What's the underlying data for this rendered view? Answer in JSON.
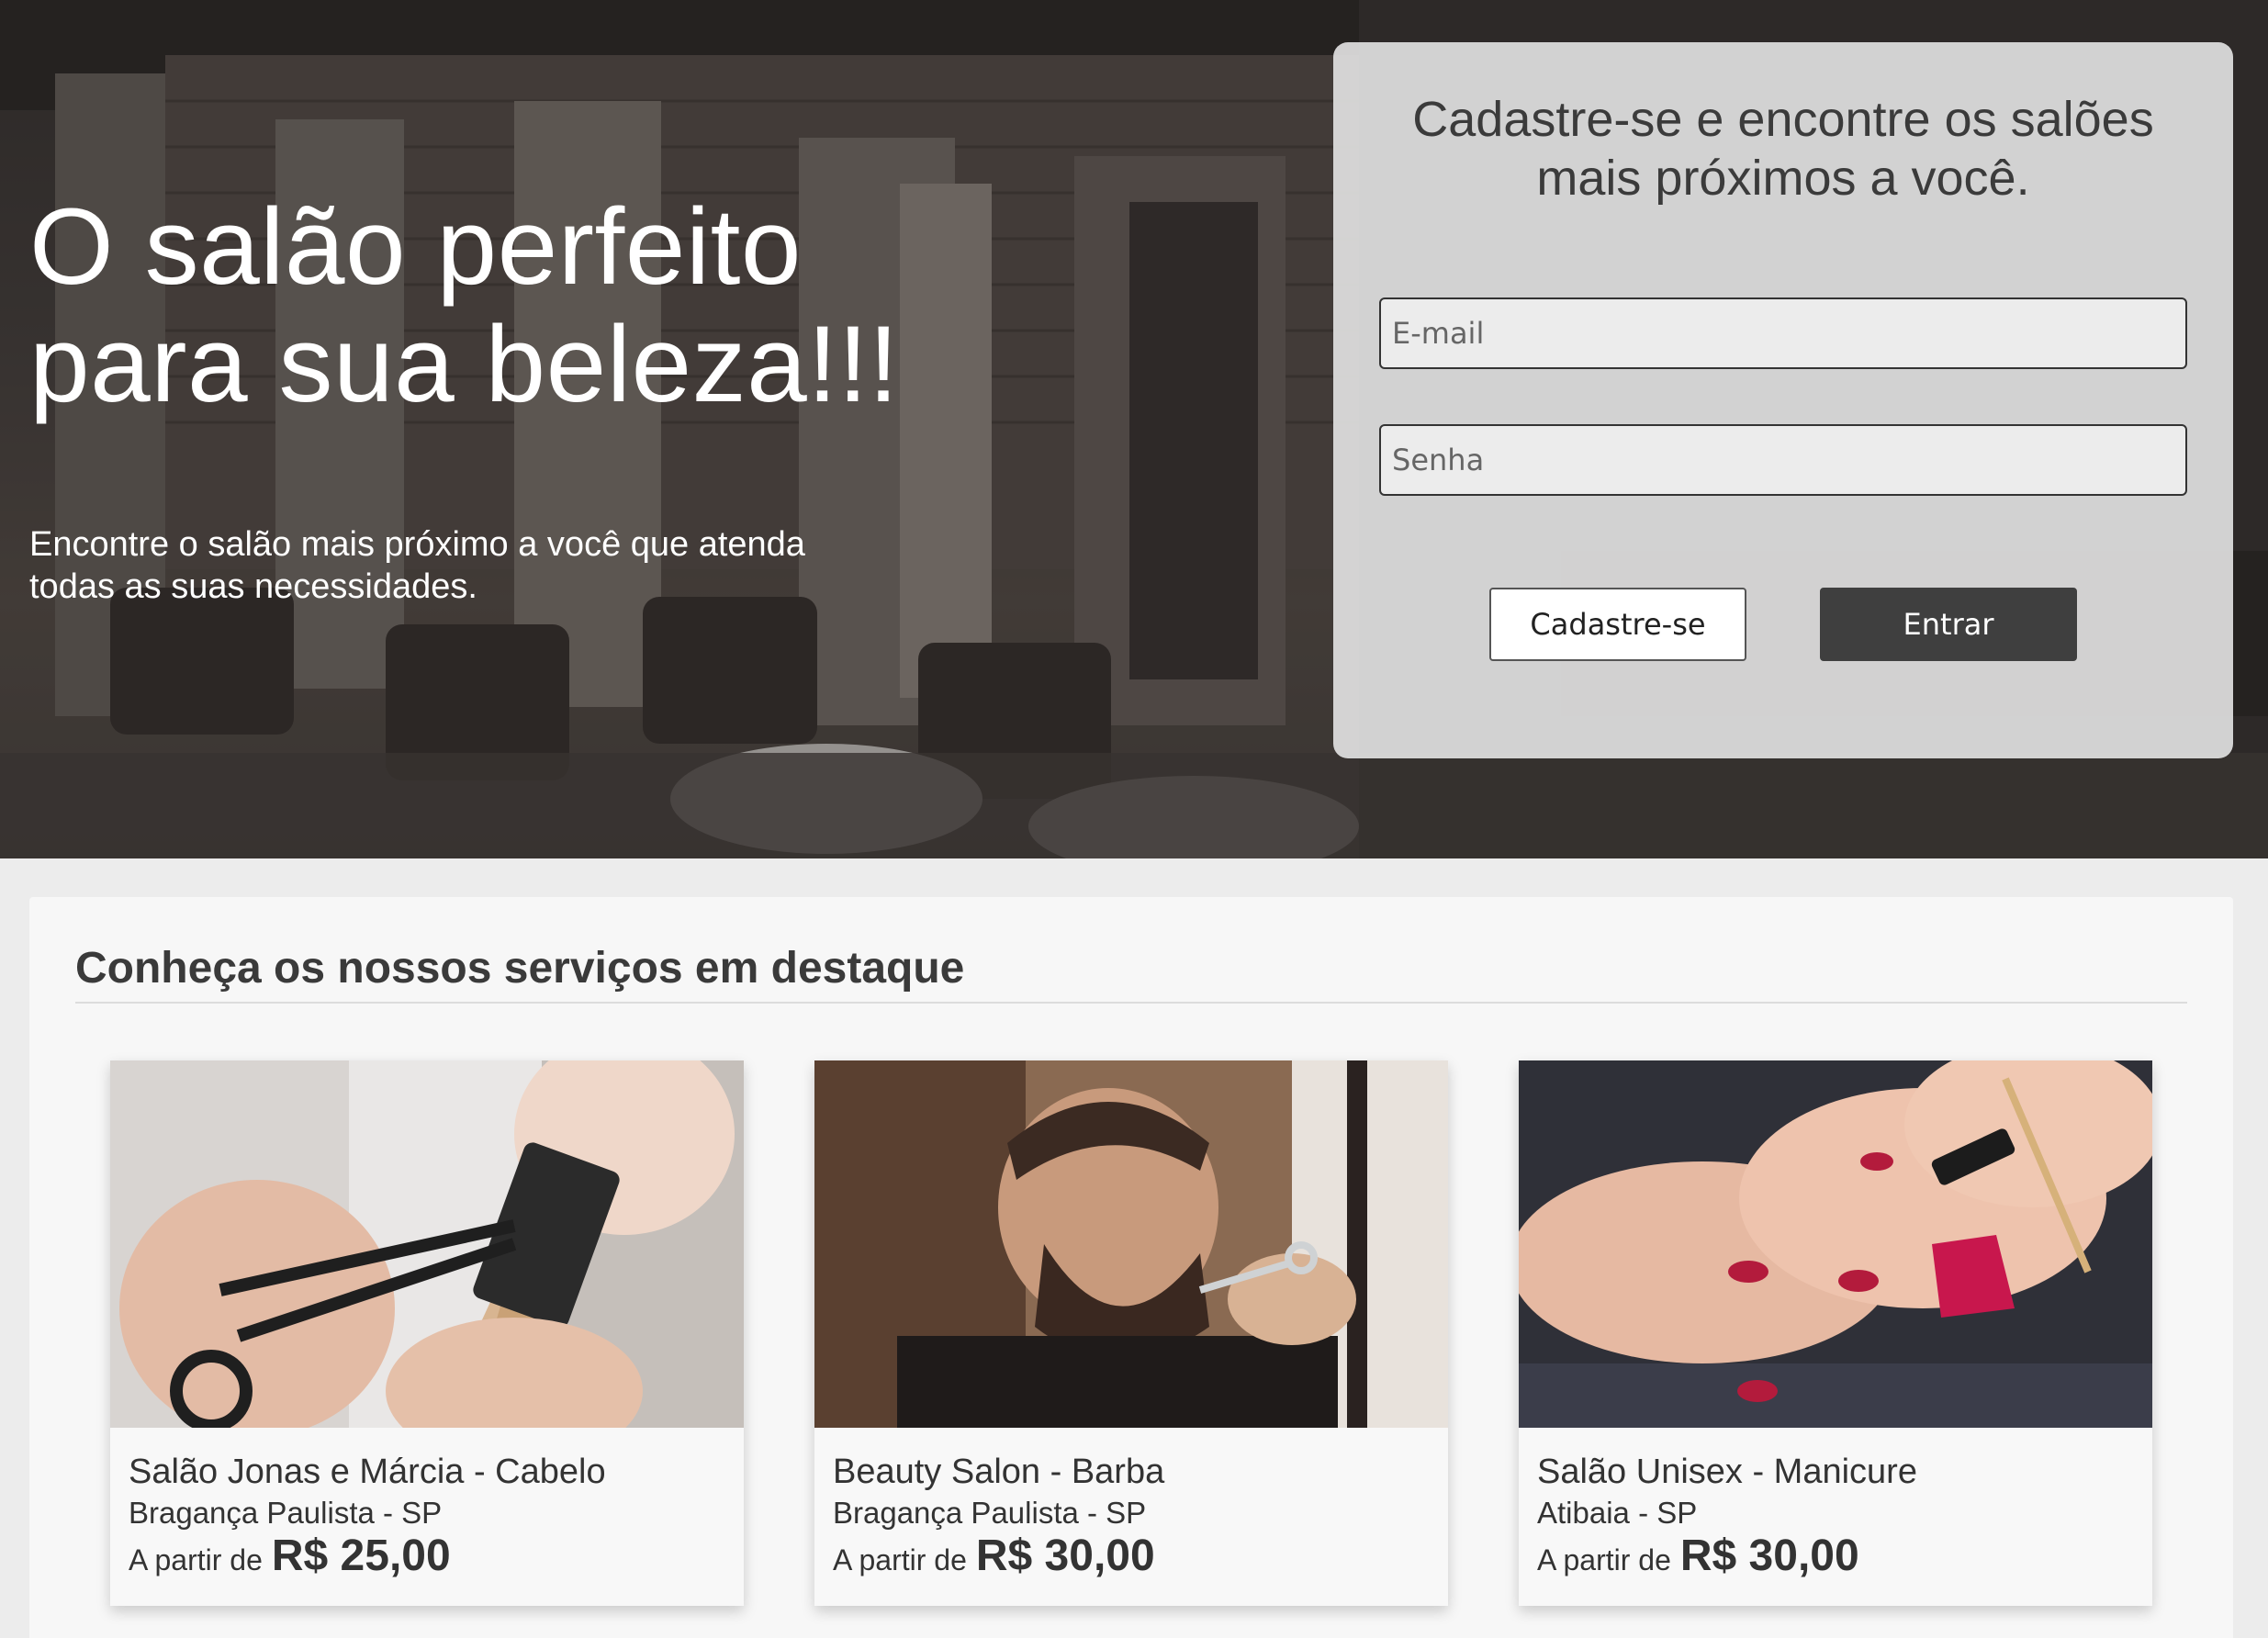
{
  "hero": {
    "title_line1": "O salão perfeito",
    "title_line2": "para sua beleza!!!",
    "subtitle_line1": "Encontre o salão mais próximo a você que atenda",
    "subtitle_line2": "todas as suas necessidades."
  },
  "login": {
    "title_line1": "Cadastre-se e encontre os salões",
    "title_line2": "mais próximos a você.",
    "email_placeholder": "E-mail",
    "password_placeholder": "Senha",
    "signup_label": "Cadastre-se",
    "login_label": "Entrar"
  },
  "services": {
    "title": "Conheça os nossos serviços em destaque",
    "cards": [
      {
        "name": "Salão Jonas e Márcia - Cabelo",
        "location": "Bragança Paulista - SP",
        "from_label": "A partir de",
        "price": "R$ 25,00",
        "image": "haircut-photo"
      },
      {
        "name": "Beauty Salon - Barba",
        "location": "Bragança Paulista - SP",
        "from_label": "A partir de",
        "price": "R$ 30,00",
        "image": "beard-trim-photo"
      },
      {
        "name": "Salão Unisex - Manicure",
        "location": "Atibaia - SP",
        "from_label": "A partir de",
        "price": "R$ 30,00",
        "image": "manicure-photo"
      }
    ]
  }
}
